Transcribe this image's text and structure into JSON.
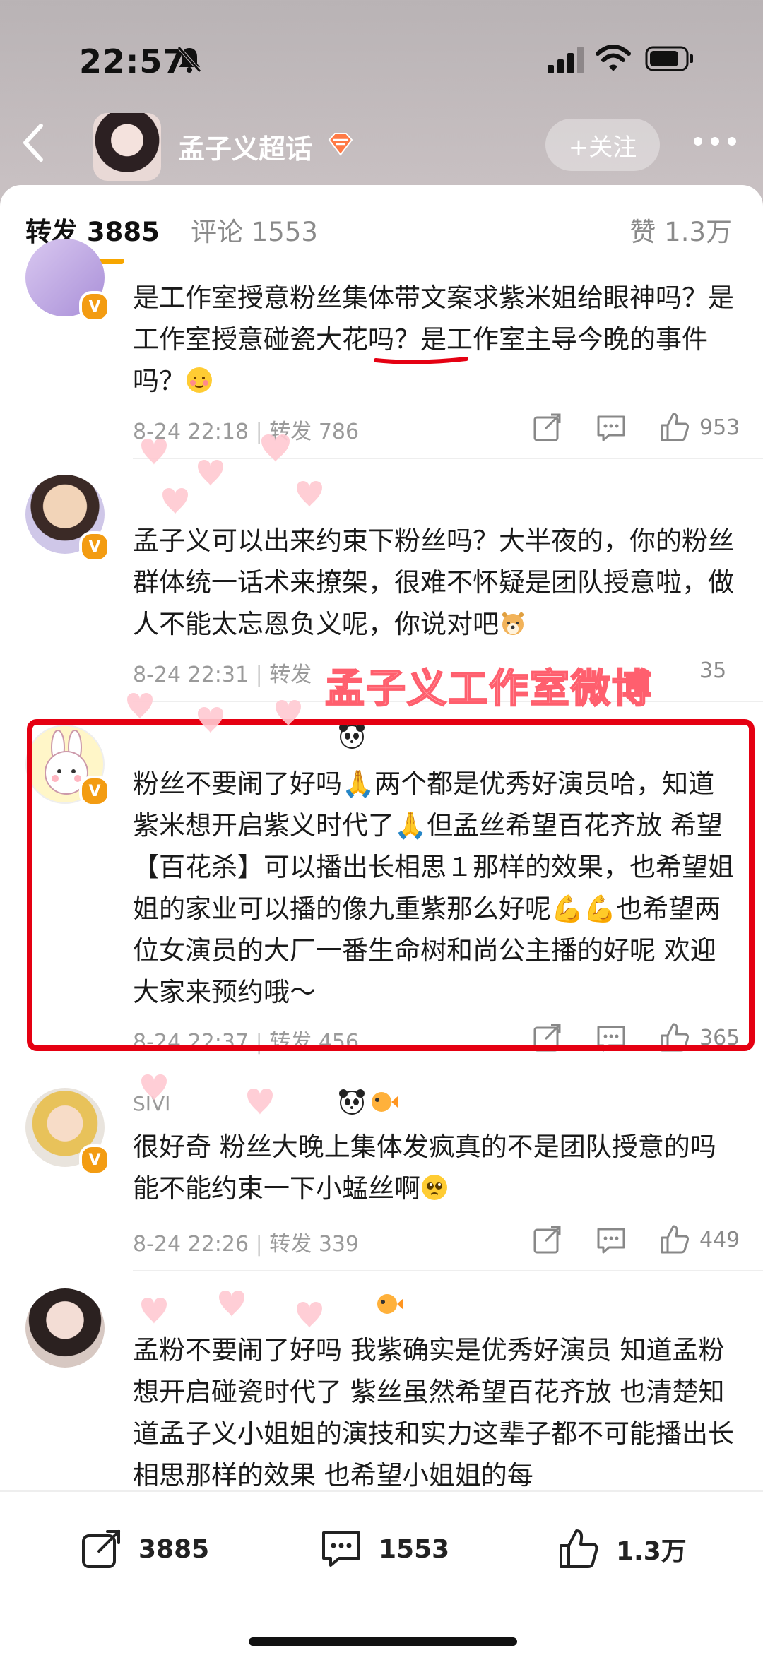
{
  "status": {
    "time": "22:57"
  },
  "topnav": {
    "title": "孟子义超话",
    "follow_label": "+关注"
  },
  "tabs": {
    "repost_label": "转发",
    "repost_count": "3885",
    "comment_label": "评论",
    "comment_count": "1553",
    "like_label": "赞",
    "like_count": "1.3万"
  },
  "watermark": "孟子义工作室微博",
  "comments": [
    {
      "text": "是工作室授意粉丝集体带文案求紫米姐给眼神吗？是工作室授意碰瓷大花吗？是工作室主导今晚的事件吗？",
      "time": "8-24 22:18",
      "repost": "转发 786",
      "likes": "953"
    },
    {
      "text": "孟子义可以出来约束下粉丝吗？大半夜的，你的粉丝群体统一话术来撩架，很难不怀疑是团队授意啦，做人不能太忘恩负义呢，你说对吧",
      "time": "8-24 22:31",
      "repost": "转发",
      "likes": "35"
    },
    {
      "text": "粉丝不要闹了好吗🙏两个都是优秀好演员哈，知道紫米想开启紫义时代了🙏但孟丝希望百花齐放 希望【百花杀】可以播出长相思１那样的效果，也希望姐姐的家业可以播的像九重紫那么好呢💪💪也希望两位女演员的大厂一番生命树和尚公主播的好呢 欢迎大家来预约哦～",
      "time": "8-24 22:37",
      "repost": "转发 456",
      "likes": "365"
    },
    {
      "name_fragment": "SIVI",
      "text": "很好奇 粉丝大晚上集体发疯真的不是团队授意的吗 能不能约束一下小蜢丝啊",
      "time": "8-24 22:26",
      "repost": "转发 339",
      "likes": "449"
    },
    {
      "text": "孟粉不要闹了好吗 我紫确实是优秀好演员 知道孟粉想开启碰瓷时代了 紫丝虽然希望百花齐放 也清楚知道孟子义小姐姐的演技和实力这辈子都不可能播出长相思那样的效果 也希望小姐姐的每"
    }
  ],
  "bottom": {
    "repost": "3885",
    "comment": "1553",
    "like": "1.3万"
  },
  "icons": [
    "bell-muted-icon",
    "signal-icon",
    "wifi-icon",
    "battery-icon",
    "back-icon",
    "gem-icon",
    "more-icon",
    "share-icon",
    "comment-icon",
    "like-icon"
  ]
}
